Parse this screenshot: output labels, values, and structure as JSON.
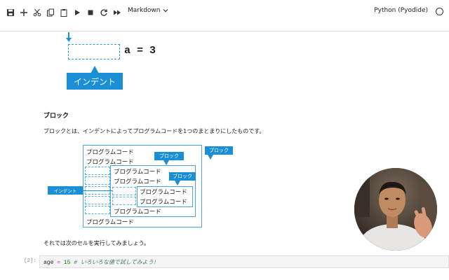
{
  "toolbar": {
    "cell_type": "Markdown",
    "kernel_name": "Python (Pyodide)"
  },
  "top_diagram": {
    "code_text": "a = 3",
    "indent_label": "インデント"
  },
  "section": {
    "heading": "ブロック",
    "description": "ブロックとは、インデントによってプログラムコードを1つのまとまりにしたものです。"
  },
  "block_diagram": {
    "lines": [
      "プログラムコード",
      "プログラムコード",
      "プログラムコード",
      "プログラムコード",
      "プログラムコード",
      "プログラムコード",
      "プログラムコード",
      "プログラムコード"
    ],
    "callout_block_outer": "ブロック",
    "callout_block_mid": "ブロック",
    "callout_block_inner": "ブロック",
    "indent_tag": "インデント"
  },
  "closing_text": "それでは次のセルを実行してみましょう。",
  "code_cell": {
    "prompt": "[2]:",
    "var": "age",
    "op": "=",
    "num": "15",
    "comment": "# いろいろな値で試してみよう!"
  },
  "colors": {
    "accent": "#1a8fd6",
    "toolbar_border": "#dcdcdc",
    "code_bg": "#f5f5f5"
  }
}
